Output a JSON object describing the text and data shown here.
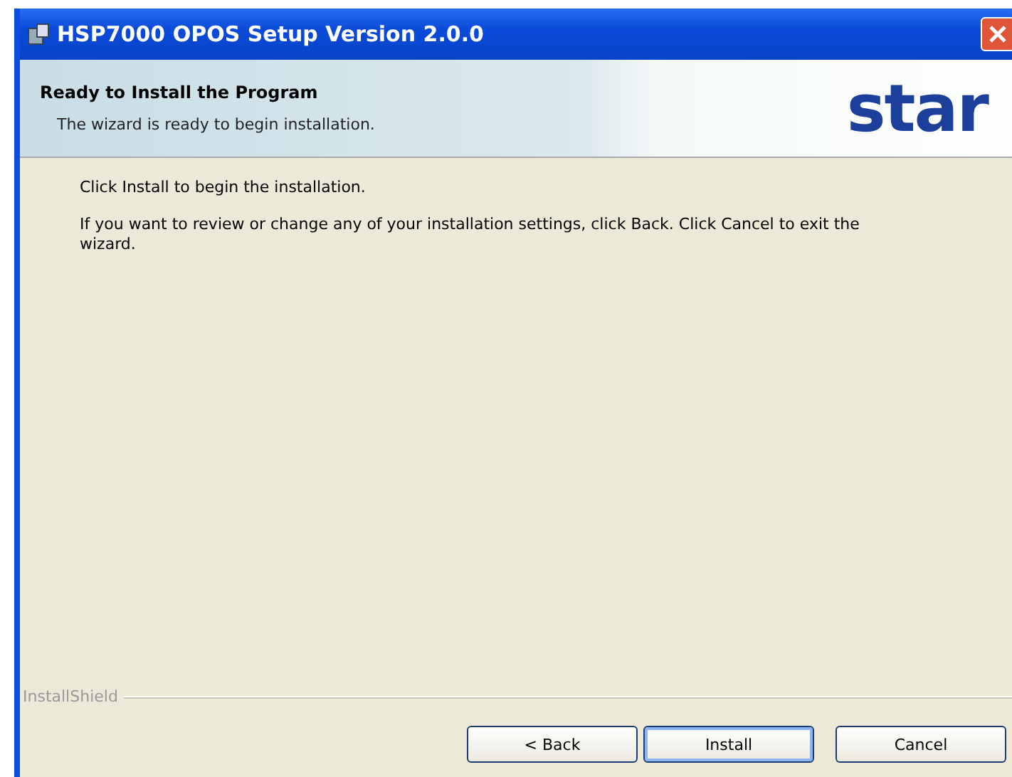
{
  "window": {
    "title": "HSP7000 OPOS Setup Version 2.0.0"
  },
  "header": {
    "title": "Ready to Install the Program",
    "subtitle": "The wizard is ready to begin installation.",
    "logo": "star"
  },
  "body": {
    "paragraphs": [
      "Click Install to begin the installation.",
      "If you want to review or change any of your installation settings, click Back. Click Cancel to exit the wizard."
    ]
  },
  "footer": {
    "brand": "InstallShield"
  },
  "buttons": [
    {
      "label": "< Back",
      "default": false
    },
    {
      "label": "Install",
      "default": true
    },
    {
      "label": "Cancel",
      "default": false
    }
  ]
}
